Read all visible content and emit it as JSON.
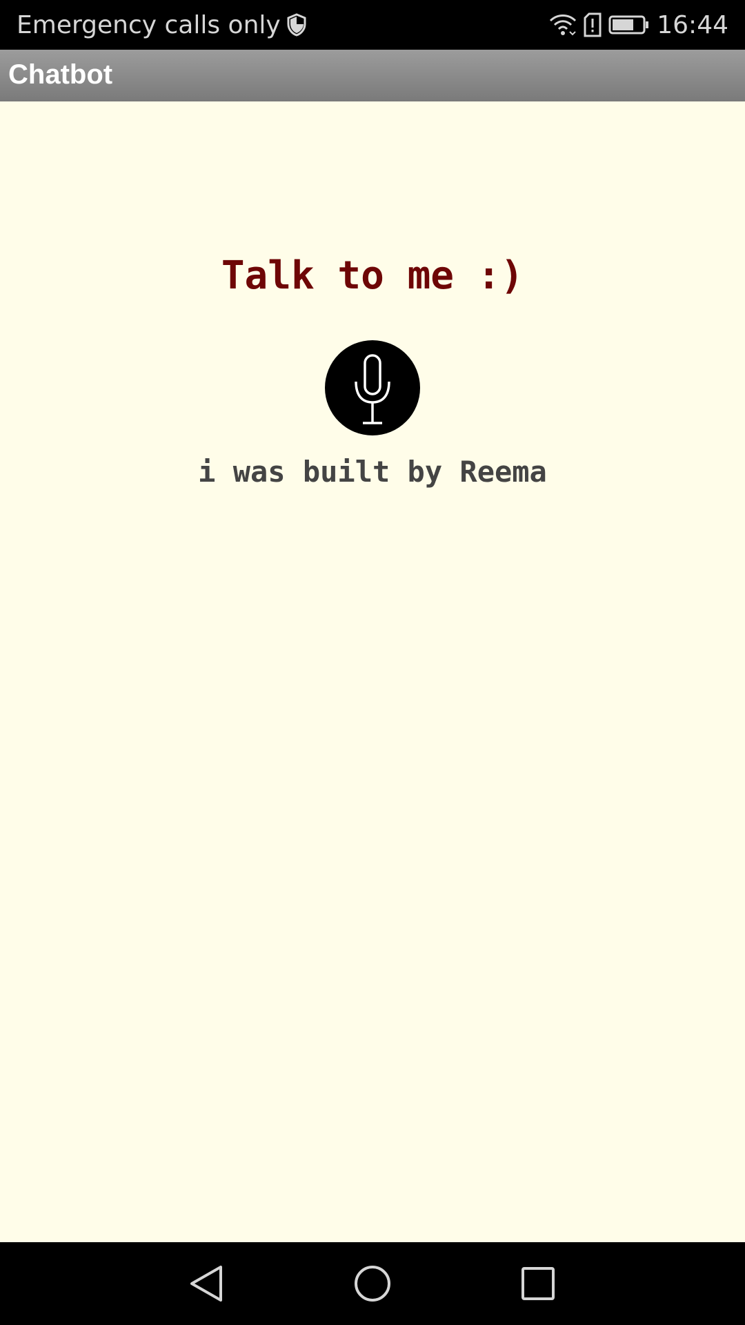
{
  "status_bar": {
    "carrier_text": "Emergency calls only",
    "time": "16:44",
    "icons": [
      "shield-icon",
      "wifi-icon",
      "sim-alert-icon",
      "battery-icon"
    ]
  },
  "app_bar": {
    "title": "Chatbot"
  },
  "main": {
    "headline": "Talk to me :)",
    "mic_icon": "microphone-icon",
    "credit": "i was built by Reema"
  },
  "nav_bar": {
    "icons": [
      "back-icon",
      "home-icon",
      "recents-icon"
    ]
  },
  "colors": {
    "background": "#fffde9",
    "headline": "#6e0606",
    "credit": "#444444",
    "app_bar": "#8a8a8a"
  }
}
